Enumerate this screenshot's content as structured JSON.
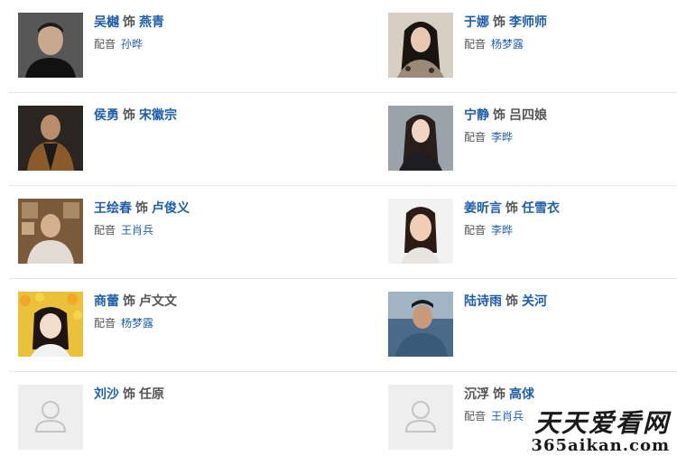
{
  "separator_label": "饰",
  "dub_label": "配音",
  "cast": [
    {
      "actor": "吴樾",
      "role": "燕青",
      "role_linked": true,
      "dub": "孙晔",
      "photo": "actor-photo"
    },
    {
      "actor": "于娜",
      "role": "李师师",
      "role_linked": true,
      "dub": "杨梦露",
      "photo": "actor-photo"
    },
    {
      "actor": "侯勇",
      "role": "宋徽宗",
      "role_linked": true,
      "dub": "",
      "photo": "actor-photo"
    },
    {
      "actor": "宁静",
      "role": "吕四娘",
      "role_linked": false,
      "dub": "李晔",
      "photo": "actor-photo"
    },
    {
      "actor": "王绘春",
      "role": "卢俊义",
      "role_linked": true,
      "dub": "王肖兵",
      "photo": "actor-photo"
    },
    {
      "actor": "姜昕言",
      "role": "任雪衣",
      "role_linked": true,
      "dub": "李晔",
      "photo": "actor-photo"
    },
    {
      "actor": "商蕾",
      "role": "卢文文",
      "role_linked": false,
      "dub": "杨梦露",
      "photo": "actor-photo"
    },
    {
      "actor": "陆诗雨",
      "role": "关河",
      "role_linked": true,
      "dub": "",
      "photo": "actor-photo"
    },
    {
      "actor": "刘沙",
      "role": "任原",
      "role_linked": false,
      "dub": "",
      "photo": "placeholder-avatar-icon"
    },
    {
      "actor": "沉浮",
      "role": "高俅",
      "role_linked": true,
      "dub": "王肖兵",
      "photo": "placeholder-avatar-icon",
      "actor_linked": false
    }
  ],
  "watermark": {
    "cn": "天天爱看网",
    "url": "365aikan.com"
  },
  "colors": {
    "link": "#1f5ea8",
    "text": "#555555",
    "divider": "#e6e6e6",
    "placeholder_bg": "#eeeeee"
  }
}
